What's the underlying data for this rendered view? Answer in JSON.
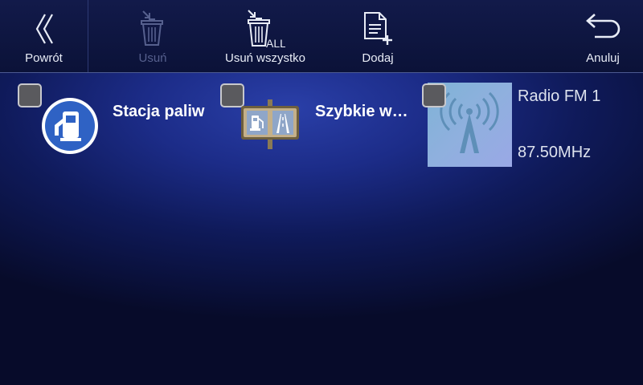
{
  "toolbar": {
    "back_label": "Powrót",
    "delete_label": "Usuń",
    "delete_all_label": "Usuń wszystko",
    "delete_all_icon_text": "ALL",
    "add_label": "Dodaj",
    "cancel_label": "Anuluj"
  },
  "items": [
    {
      "title": "Stacja paliw",
      "icon": "fuel-station-icon"
    },
    {
      "title": "Szybkie w…",
      "icon": "road-sign-icon"
    },
    {
      "name": "Radio FM 1",
      "frequency": "87.50MHz",
      "icon": "radio-tower-icon"
    }
  ],
  "colors": {
    "background": "#1c2c88",
    "toolbar": "#0f163f",
    "checkbox": "#5a5a5e",
    "fuel_icon": "#2f62c4"
  }
}
